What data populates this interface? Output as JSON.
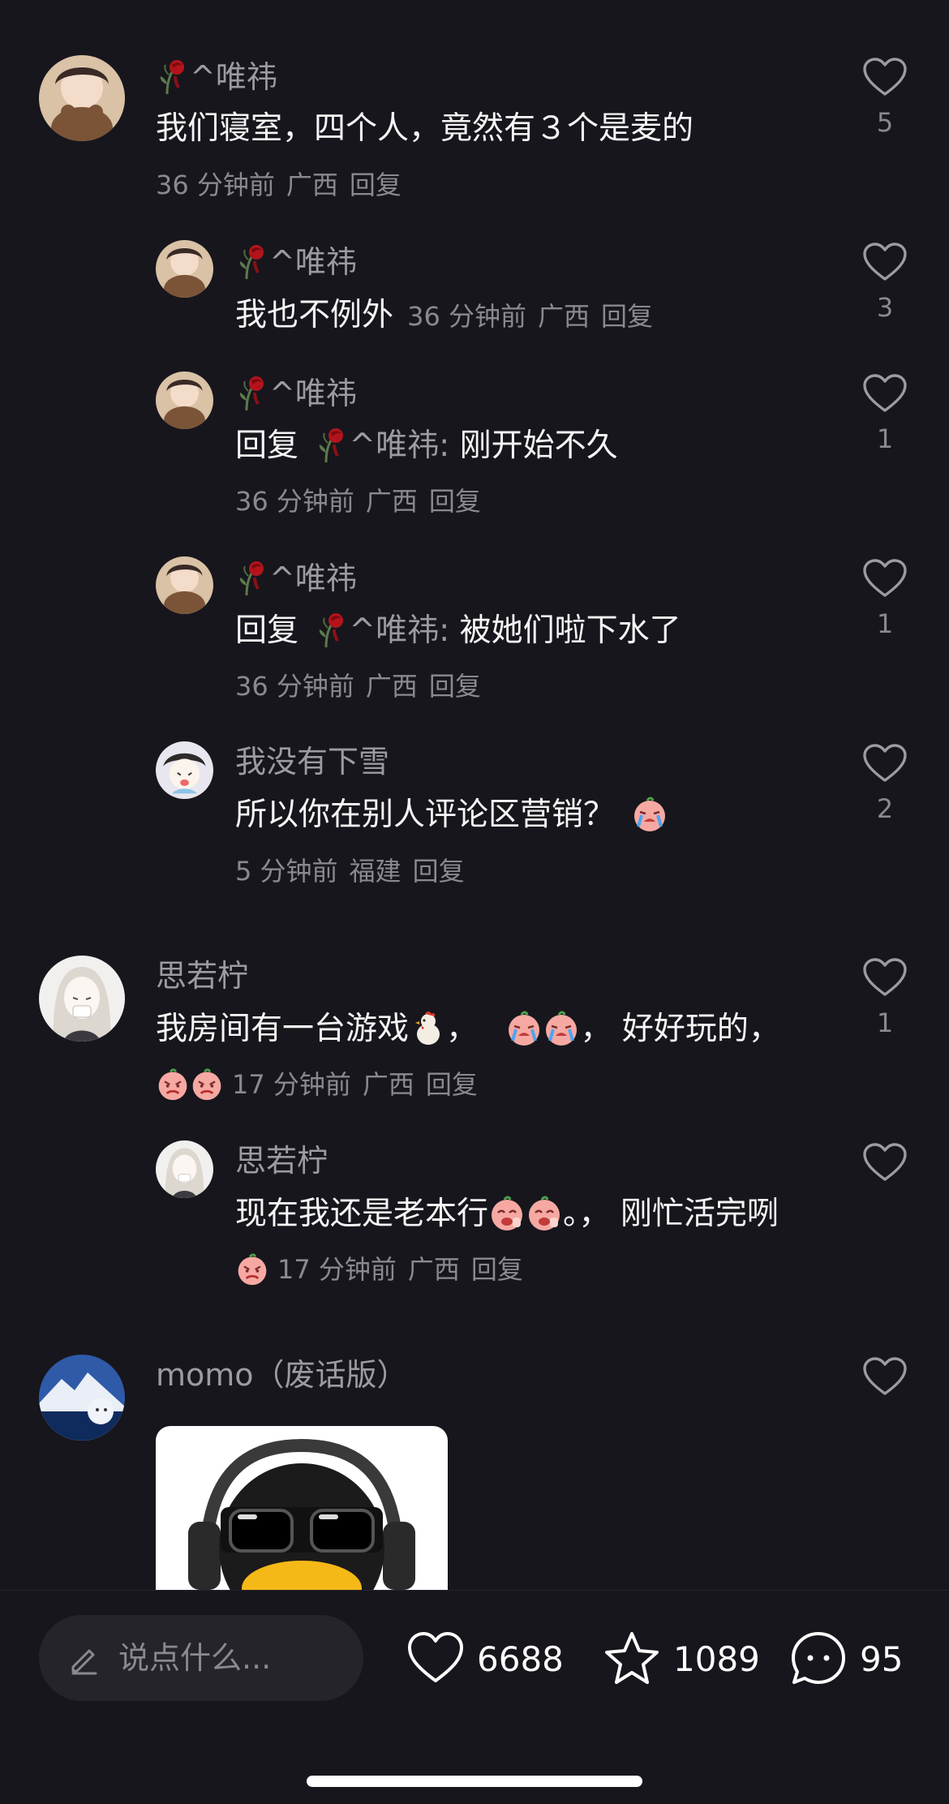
{
  "comments": [
    {
      "name": "^唯祎",
      "text": "我们寝室，四个人，竟然有３个是麦的",
      "time": "36 分钟前",
      "region": "广西",
      "reply": "回复",
      "likes": "5",
      "replies": [
        {
          "name": "^唯祎",
          "text": "我也不例外",
          "time": "36 分钟前",
          "region": "广西",
          "reply": "回复",
          "likes": "3"
        },
        {
          "name": "^唯祎",
          "prefix": "回复",
          "target": "^唯祎:",
          "text": "刚开始不久",
          "time": "36 分钟前",
          "region": "广西",
          "reply": "回复",
          "likes": "1"
        },
        {
          "name": "^唯祎",
          "prefix": "回复",
          "target": "^唯祎:",
          "text": "被她们啦下水了",
          "time": "36 分钟前",
          "region": "广西",
          "reply": "回复",
          "likes": "1"
        },
        {
          "name": "我没有下雪",
          "text": "所以你在别人评论区营销？",
          "time": "5 分钟前",
          "region": "福建",
          "reply": "回复",
          "likes": "2"
        }
      ]
    },
    {
      "name": "思若柠",
      "text_a": "我房间有一台游戏",
      "text_b": "，",
      "text_c": "，  好好玩的，",
      "time": "17 分钟前",
      "region": "广西",
      "reply": "回复",
      "likes": "1",
      "replies": [
        {
          "name": "思若柠",
          "text_a": "现在我还是老本行",
          "text_b": "。，  刚忙活完咧",
          "time": "17 分钟前",
          "region": "广西",
          "reply": "回复"
        }
      ]
    },
    {
      "name": "momo（废话版）"
    }
  ],
  "bottom_bar": {
    "input_placeholder": "说点什么...",
    "likes": "6688",
    "favorites": "1089",
    "comments": "95"
  },
  "icons": {
    "like": "heart-outline-icon",
    "favorite": "star-outline-icon",
    "comment": "chat-bubble-icon",
    "edit": "pencil-icon"
  },
  "colors": {
    "background": "#17161d",
    "text_primary": "#ffffff",
    "text_secondary": "#9c9ba1"
  }
}
